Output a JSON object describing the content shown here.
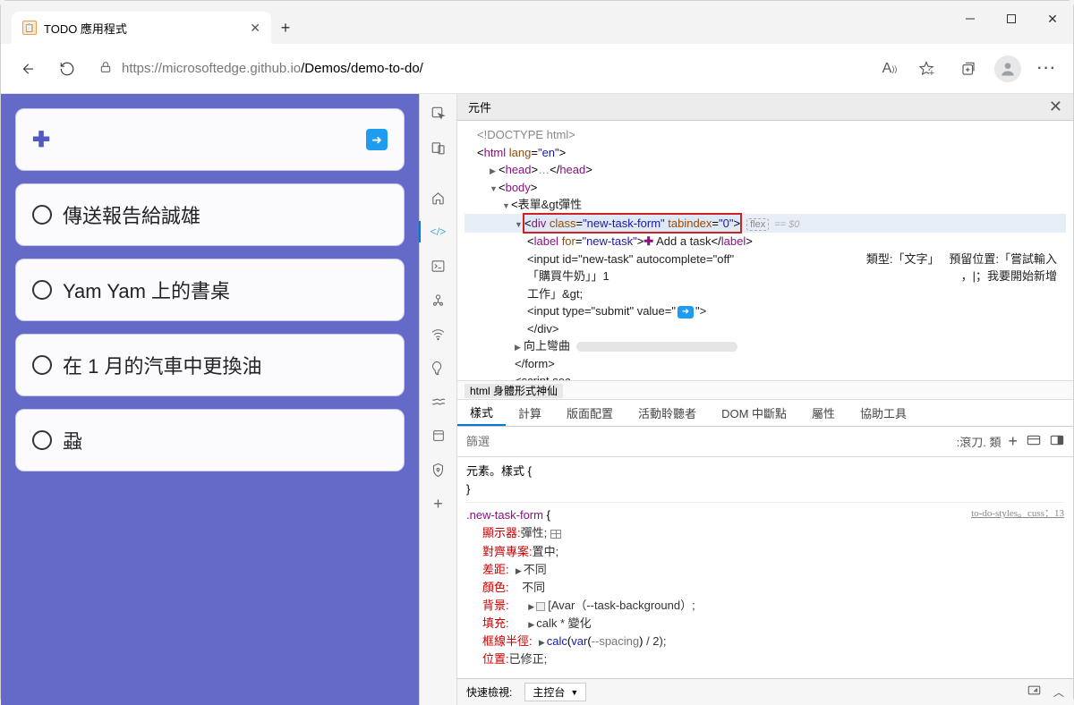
{
  "window": {
    "tab_title": "TODO 應用程式",
    "url_prefix": "https://",
    "url_grey1": "microsoftedge.github.io",
    "url_black": "/Demos/demo-to-do/"
  },
  "app": {
    "tasks": [
      "傳送報告給誠雄",
      "Yam Yam 上的書桌",
      "在 1 月的汽車中更換油",
      "蝨"
    ]
  },
  "devtools": {
    "elements_tab": "元件",
    "dom": {
      "doctype": "<!DOCTYPE html>",
      "html_open": "html",
      "html_lang_attr": "lang",
      "html_lang_val": "\"en\"",
      "head": "head",
      "head_ellipsis": "…",
      "body": "body",
      "form_text": "表單&gt彈性",
      "sel_div": "div",
      "sel_class_attr": "class",
      "sel_class_val": "\"new-task-form\"",
      "sel_tab_attr": "tabindex",
      "sel_tab_val": "\"0\"",
      "flex_badge": "flex",
      "eq0": "== $0",
      "label_tag": "label",
      "label_for_attr": "for",
      "label_for_val": "\"new-task\"",
      "label_text": " Add a task",
      "input1": "<input id=\"new-task\" autocomplete=\"off\"",
      "input1_type": "類型:「文字」",
      "input1_placeholder": "預留位置:「嘗試輸入",
      "input1_line2a": "「購買牛奶」」1",
      "input1_line2b": "，|；我要開始新增",
      "input1_line3": "工作」&gt;",
      "input2a": "<input type=\"submit\" value=\"",
      "input2b": "\">",
      "div_close": "</div>",
      "ul_text": "向上彎曲",
      "form_close": "</form>",
      "script_text": "<script sec"
    },
    "crumb": "html 身體形式神仙",
    "styles_tabs": [
      "樣式",
      "計算",
      "版面配置",
      "活動聆聽者",
      "DOM 中斷點",
      "屬性",
      "協助工具"
    ],
    "filter_placeholder": "篩選",
    "hov": ":滾刀. 類",
    "element_style": "元素。樣式 {",
    "rule_selector": ".new-task-form",
    "source_link": "to-do-styles。cuss：13",
    "props": {
      "display_k": "顯示器:",
      "display_v": "彈性;",
      "align_k": "對齊專案:",
      "align_v": "置中;",
      "gap_k": "差距:",
      "gap_v": "不同",
      "color_k": "顏色:",
      "color_v": "不同",
      "bg_k": "背景:",
      "bg_v": "[Avar（--task-background）;",
      "pad_k": "填充:",
      "pad_v": "calk * 變化",
      "br_k": "框線半徑:",
      "br_v_a": "calc",
      "br_v_b": "var",
      "br_v_c": "--spacing",
      "br_v_d": " / 2);",
      "pos_k": "位置:",
      "pos_v": "已修正;"
    },
    "drawer": {
      "label": "快速檢視:",
      "select": "主控台"
    }
  }
}
